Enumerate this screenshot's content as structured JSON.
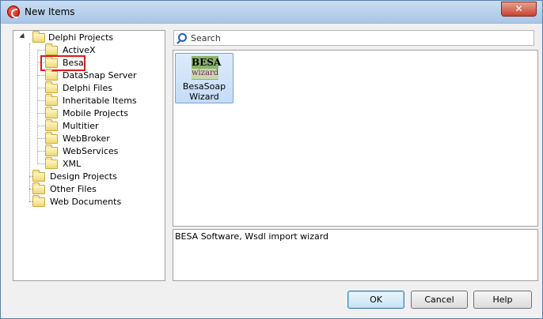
{
  "window": {
    "title": "New Items",
    "close_glyph": "✕"
  },
  "tree": {
    "root": {
      "label": "Delphi Projects",
      "icon": "folder-icon"
    },
    "children": [
      {
        "label": "ActiveX"
      },
      {
        "label": "Besa",
        "selected": true
      },
      {
        "label": "DataSnap Server"
      },
      {
        "label": "Delphi Files"
      },
      {
        "label": "Inheritable Items"
      },
      {
        "label": "Mobile Projects"
      },
      {
        "label": "Multitier"
      },
      {
        "label": "WebBroker"
      },
      {
        "label": "WebServices"
      },
      {
        "label": "XML"
      }
    ],
    "siblings": [
      {
        "label": "Design Projects"
      },
      {
        "label": "Other Files"
      },
      {
        "label": "Web Documents"
      }
    ]
  },
  "search": {
    "placeholder": "Search"
  },
  "items": [
    {
      "icon_top": "BESA",
      "icon_bottom": "wizard",
      "label_line1": "BesaSoap",
      "label_line2": "Wizard"
    }
  ],
  "description": "BESA Software, Wsdl import wizard",
  "buttons": {
    "ok": "OK",
    "cancel": "Cancel",
    "help": "Help"
  },
  "colors": {
    "highlight": "#e01818",
    "selection": "#c4dcf7",
    "icon_green": "#8ab36a"
  }
}
